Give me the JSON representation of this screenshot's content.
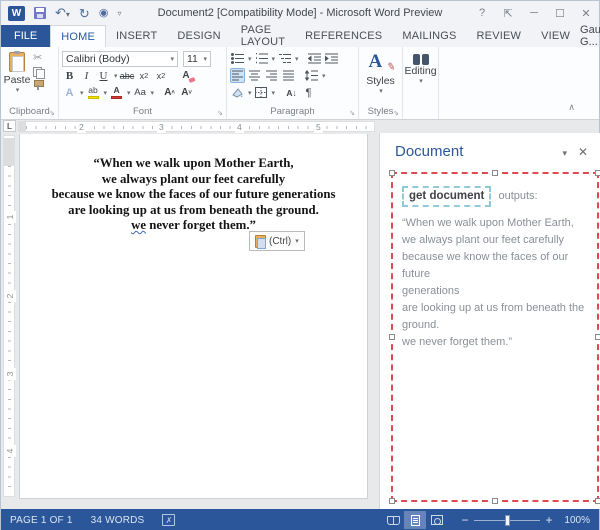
{
  "window": {
    "title": "Document2 [Compatibility Mode] - Microsoft Word Preview"
  },
  "tabs": {
    "file": "FILE",
    "items": [
      "HOME",
      "INSERT",
      "DESIGN",
      "PAGE LAYOUT",
      "REFERENCES",
      "MAILINGS",
      "REVIEW",
      "VIEW"
    ],
    "user": "Gaurav G..."
  },
  "ribbon": {
    "paste_label": "Paste",
    "font_name": "Calibri (Body)",
    "font_size": "11",
    "buttons": {
      "bold": "B",
      "italic": "I",
      "underline": "U",
      "strikethrough": "abc",
      "sub_base": "x",
      "sub_mark": "2",
      "sup_base": "x",
      "sup_mark": "2",
      "clear_formatting": "A",
      "text_effects": "A",
      "highlight": "ab",
      "font_color": "A",
      "change_case": "Aa",
      "grow_font": "A",
      "shrink_font": "A",
      "sort": "A",
      "pilcrow": "¶"
    },
    "group_labels": {
      "clipboard": "Clipboard",
      "font": "Font",
      "paragraph": "Paragraph",
      "styles": "Styles",
      "editing": "Editing"
    },
    "styles_button": "Styles",
    "editing_button": "Editing"
  },
  "ruler": {
    "tab_stop": "L",
    "h_numbers": [
      "2",
      "3",
      "4",
      "5"
    ],
    "v_numbers": [
      "1",
      "2",
      "3",
      "4"
    ]
  },
  "document": {
    "lines": [
      "“When we walk upon Mother Earth,",
      "we always plant our feet carefully",
      "because we know the faces of our future generations",
      "are looking up at us from beneath the ground."
    ],
    "grammar_word": "we",
    "last_line_rest": " never forget them.”",
    "paste_options_label": "(Ctrl)"
  },
  "task_pane": {
    "title": "Document",
    "button_label": "get document",
    "outputs_label": "outputs:",
    "display_lines": [
      "“When we walk upon Mother Earth,",
      "we always plant our feet carefully",
      "because we know the faces of our future",
      "generations",
      "are looking up at us from beneath the",
      "ground.",
      "we never forget them.”"
    ]
  },
  "status_bar": {
    "page": "PAGE 1 OF 1",
    "words": "34 WORDS",
    "zoom": "100%"
  },
  "colors": {
    "accent": "#2b579a",
    "selection_red": "#e0494f",
    "snippet_teal": "#8fc9da"
  }
}
